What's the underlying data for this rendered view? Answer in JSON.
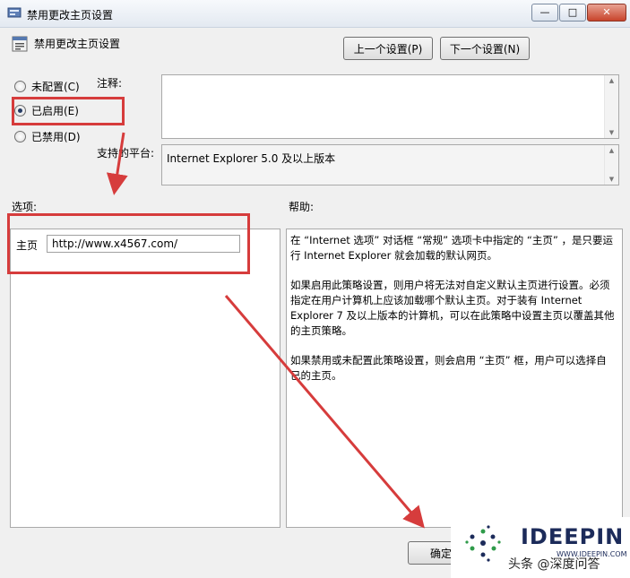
{
  "window": {
    "title": "禁用更改主页设置",
    "controls": [
      "—",
      "□",
      "✕"
    ]
  },
  "header": {
    "title": "禁用更改主页设置",
    "prev_label": "上一个设置(P)",
    "next_label": "下一个设置(N)"
  },
  "state": {
    "options": [
      {
        "label": "未配置(C)",
        "selected": false
      },
      {
        "label": "已启用(E)",
        "selected": true
      },
      {
        "label": "已禁用(D)",
        "selected": false
      }
    ]
  },
  "comment": {
    "label": "注释:",
    "value": ""
  },
  "platform": {
    "label": "支持的平台:",
    "value": "Internet Explorer 5.0 及以上版本"
  },
  "options_section": {
    "label": "选项:",
    "homepage_label": "主页",
    "homepage_value": "http://www.x4567.com/"
  },
  "help_section": {
    "label": "帮助:",
    "paragraphs": [
      "在 “Internet 选项” 对话框 “常规” 选项卡中指定的 “主页” ，是只要运行 Internet Explorer 就会加载的默认网页。",
      "如果启用此策略设置，则用户将无法对自定义默认主页进行设置。必须指定在用户计算机上应该加载哪个默认主页。对于装有 Internet Explorer 7 及以上版本的计算机，可以在此策略中设置主页以覆盖其他的主页策略。",
      "如果禁用或未配置此策略设置，则会启用 “主页” 框，用户可以选择自己的主页。"
    ]
  },
  "footer": {
    "ok_label": "确定"
  },
  "watermark": {
    "brand": "IDEEPIN",
    "url": "WWW.IDEEPIN.COM",
    "caption": "头条 @深度问答"
  },
  "colors": {
    "highlight": "#d63c3c",
    "brand": "#1c2b5a"
  }
}
